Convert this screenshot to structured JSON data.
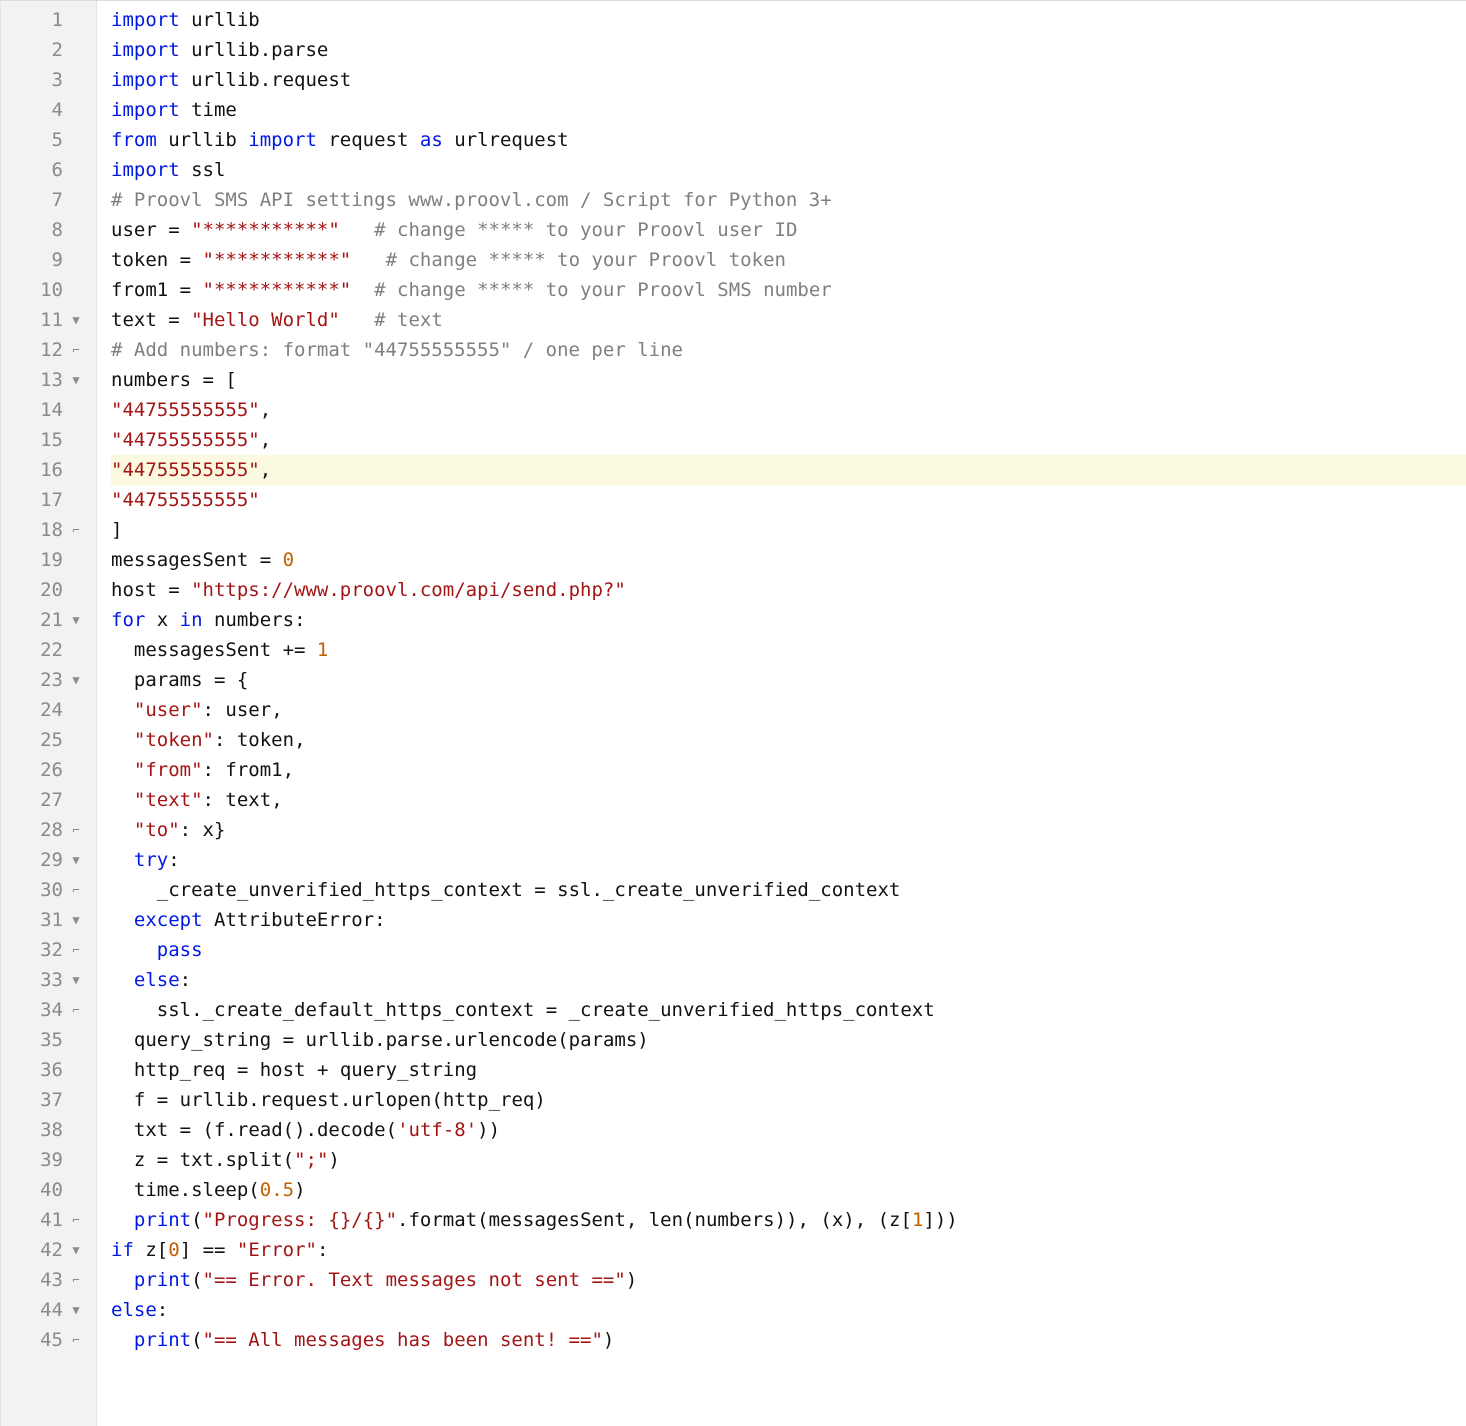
{
  "lines": [
    {
      "n": 1,
      "fold": "",
      "hl": false,
      "segs": [
        [
          "kw",
          "import"
        ],
        [
          "id",
          " urllib"
        ]
      ]
    },
    {
      "n": 2,
      "fold": "",
      "hl": false,
      "segs": [
        [
          "kw",
          "import"
        ],
        [
          "id",
          " urllib"
        ],
        [
          "op",
          "."
        ],
        [
          "id",
          "parse"
        ]
      ]
    },
    {
      "n": 3,
      "fold": "",
      "hl": false,
      "segs": [
        [
          "kw",
          "import"
        ],
        [
          "id",
          " urllib"
        ],
        [
          "op",
          "."
        ],
        [
          "id",
          "request"
        ]
      ]
    },
    {
      "n": 4,
      "fold": "",
      "hl": false,
      "segs": [
        [
          "kw",
          "import"
        ],
        [
          "id",
          " time"
        ]
      ]
    },
    {
      "n": 5,
      "fold": "",
      "hl": false,
      "segs": [
        [
          "kw",
          "from"
        ],
        [
          "id",
          " urllib "
        ],
        [
          "kw",
          "import"
        ],
        [
          "id",
          " request "
        ],
        [
          "kw",
          "as"
        ],
        [
          "id",
          " urlrequest"
        ]
      ]
    },
    {
      "n": 6,
      "fold": "",
      "hl": false,
      "segs": [
        [
          "kw",
          "import"
        ],
        [
          "id",
          " ssl"
        ]
      ]
    },
    {
      "n": 7,
      "fold": "",
      "hl": false,
      "segs": [
        [
          "cmt",
          "# Proovl SMS API settings www.proovl.com / Script for Python 3+"
        ]
      ]
    },
    {
      "n": 8,
      "fold": "",
      "hl": false,
      "segs": [
        [
          "id",
          "user "
        ],
        [
          "op",
          "= "
        ],
        [
          "str",
          "\"***********\""
        ],
        [
          "id",
          "   "
        ],
        [
          "cmt",
          "# change ***** to your Proovl user ID"
        ]
      ]
    },
    {
      "n": 9,
      "fold": "",
      "hl": false,
      "segs": [
        [
          "id",
          "token "
        ],
        [
          "op",
          "= "
        ],
        [
          "str",
          "\"***********\""
        ],
        [
          "id",
          "   "
        ],
        [
          "cmt",
          "# change ***** to your Proovl token"
        ]
      ]
    },
    {
      "n": 10,
      "fold": "",
      "hl": false,
      "segs": [
        [
          "id",
          "from1 "
        ],
        [
          "op",
          "= "
        ],
        [
          "str",
          "\"***********\""
        ],
        [
          "id",
          "  "
        ],
        [
          "cmt",
          "# change ***** to your Proovl SMS number"
        ]
      ]
    },
    {
      "n": 11,
      "fold": "▼",
      "hl": false,
      "segs": [
        [
          "id",
          "text "
        ],
        [
          "op",
          "= "
        ],
        [
          "str",
          "\"Hello World\""
        ],
        [
          "id",
          "   "
        ],
        [
          "cmt",
          "# text"
        ]
      ]
    },
    {
      "n": 12,
      "fold": "⌐",
      "hl": false,
      "segs": [
        [
          "cmt",
          "# Add numbers: format \"44755555555\" / one per line"
        ]
      ]
    },
    {
      "n": 13,
      "fold": "▼",
      "hl": false,
      "segs": [
        [
          "id",
          "numbers "
        ],
        [
          "op",
          "= ["
        ]
      ]
    },
    {
      "n": 14,
      "fold": "",
      "hl": false,
      "segs": [
        [
          "str",
          "\"44755555555\""
        ],
        [
          "op",
          ","
        ]
      ]
    },
    {
      "n": 15,
      "fold": "",
      "hl": false,
      "segs": [
        [
          "str",
          "\"44755555555\""
        ],
        [
          "op",
          ","
        ]
      ]
    },
    {
      "n": 16,
      "fold": "",
      "hl": true,
      "segs": [
        [
          "str",
          "\"44755555555\""
        ],
        [
          "op",
          ","
        ]
      ]
    },
    {
      "n": 17,
      "fold": "",
      "hl": false,
      "segs": [
        [
          "str",
          "\"44755555555\""
        ]
      ]
    },
    {
      "n": 18,
      "fold": "⌐",
      "hl": false,
      "segs": [
        [
          "op",
          "]"
        ]
      ]
    },
    {
      "n": 19,
      "fold": "",
      "hl": false,
      "segs": [
        [
          "id",
          "messagesSent "
        ],
        [
          "op",
          "= "
        ],
        [
          "num-lit",
          "0"
        ]
      ]
    },
    {
      "n": 20,
      "fold": "",
      "hl": false,
      "segs": [
        [
          "id",
          "host "
        ],
        [
          "op",
          "= "
        ],
        [
          "str",
          "\"https://www.proovl.com/api/send.php?\""
        ]
      ]
    },
    {
      "n": 21,
      "fold": "▼",
      "hl": false,
      "segs": [
        [
          "kw",
          "for"
        ],
        [
          "id",
          " x "
        ],
        [
          "kw",
          "in"
        ],
        [
          "id",
          " numbers"
        ],
        [
          "op",
          ":"
        ]
      ]
    },
    {
      "n": 22,
      "fold": "",
      "hl": false,
      "segs": [
        [
          "id",
          "  messagesSent "
        ],
        [
          "op",
          "+= "
        ],
        [
          "num-lit",
          "1"
        ]
      ]
    },
    {
      "n": 23,
      "fold": "▼",
      "hl": false,
      "segs": [
        [
          "id",
          "  params "
        ],
        [
          "op",
          "= {"
        ]
      ]
    },
    {
      "n": 24,
      "fold": "",
      "hl": false,
      "segs": [
        [
          "id",
          "  "
        ],
        [
          "str",
          "\"user\""
        ],
        [
          "op",
          ": "
        ],
        [
          "id",
          "user"
        ],
        [
          "op",
          ","
        ]
      ]
    },
    {
      "n": 25,
      "fold": "",
      "hl": false,
      "segs": [
        [
          "id",
          "  "
        ],
        [
          "str",
          "\"token\""
        ],
        [
          "op",
          ": "
        ],
        [
          "id",
          "token"
        ],
        [
          "op",
          ","
        ]
      ]
    },
    {
      "n": 26,
      "fold": "",
      "hl": false,
      "segs": [
        [
          "id",
          "  "
        ],
        [
          "str",
          "\"from\""
        ],
        [
          "op",
          ": "
        ],
        [
          "id",
          "from1"
        ],
        [
          "op",
          ","
        ]
      ]
    },
    {
      "n": 27,
      "fold": "",
      "hl": false,
      "segs": [
        [
          "id",
          "  "
        ],
        [
          "str",
          "\"text\""
        ],
        [
          "op",
          ": "
        ],
        [
          "id",
          "text"
        ],
        [
          "op",
          ","
        ]
      ]
    },
    {
      "n": 28,
      "fold": "⌐",
      "hl": false,
      "segs": [
        [
          "id",
          "  "
        ],
        [
          "str",
          "\"to\""
        ],
        [
          "op",
          ": "
        ],
        [
          "id",
          "x"
        ],
        [
          "op",
          "}"
        ]
      ]
    },
    {
      "n": 29,
      "fold": "▼",
      "hl": false,
      "segs": [
        [
          "id",
          "  "
        ],
        [
          "kw",
          "try"
        ],
        [
          "op",
          ":"
        ]
      ]
    },
    {
      "n": 30,
      "fold": "⌐",
      "hl": false,
      "segs": [
        [
          "id",
          "    _create_unverified_https_context "
        ],
        [
          "op",
          "= "
        ],
        [
          "id",
          "ssl"
        ],
        [
          "op",
          "."
        ],
        [
          "id",
          "_create_unverified_context"
        ]
      ]
    },
    {
      "n": 31,
      "fold": "▼",
      "hl": false,
      "segs": [
        [
          "id",
          "  "
        ],
        [
          "kw",
          "except"
        ],
        [
          "id",
          " AttributeError"
        ],
        [
          "op",
          ":"
        ]
      ]
    },
    {
      "n": 32,
      "fold": "⌐",
      "hl": false,
      "segs": [
        [
          "id",
          "    "
        ],
        [
          "kw",
          "pass"
        ]
      ]
    },
    {
      "n": 33,
      "fold": "▼",
      "hl": false,
      "segs": [
        [
          "id",
          "  "
        ],
        [
          "kw",
          "else"
        ],
        [
          "op",
          ":"
        ]
      ]
    },
    {
      "n": 34,
      "fold": "⌐",
      "hl": false,
      "segs": [
        [
          "id",
          "    ssl"
        ],
        [
          "op",
          "."
        ],
        [
          "id",
          "_create_default_https_context "
        ],
        [
          "op",
          "= "
        ],
        [
          "id",
          "_create_unverified_https_context"
        ]
      ]
    },
    {
      "n": 35,
      "fold": "",
      "hl": false,
      "segs": [
        [
          "id",
          "  query_string "
        ],
        [
          "op",
          "= "
        ],
        [
          "id",
          "urllib"
        ],
        [
          "op",
          "."
        ],
        [
          "id",
          "parse"
        ],
        [
          "op",
          "."
        ],
        [
          "id",
          "urlencode"
        ],
        [
          "op",
          "("
        ],
        [
          "id",
          "params"
        ],
        [
          "op",
          ")"
        ]
      ]
    },
    {
      "n": 36,
      "fold": "",
      "hl": false,
      "segs": [
        [
          "id",
          "  http_req "
        ],
        [
          "op",
          "= "
        ],
        [
          "id",
          "host "
        ],
        [
          "op",
          "+ "
        ],
        [
          "id",
          "query_string"
        ]
      ]
    },
    {
      "n": 37,
      "fold": "",
      "hl": false,
      "segs": [
        [
          "id",
          "  f "
        ],
        [
          "op",
          "= "
        ],
        [
          "id",
          "urllib"
        ],
        [
          "op",
          "."
        ],
        [
          "id",
          "request"
        ],
        [
          "op",
          "."
        ],
        [
          "id",
          "urlopen"
        ],
        [
          "op",
          "("
        ],
        [
          "id",
          "http_req"
        ],
        [
          "op",
          ")"
        ]
      ]
    },
    {
      "n": 38,
      "fold": "",
      "hl": false,
      "segs": [
        [
          "id",
          "  txt "
        ],
        [
          "op",
          "= ("
        ],
        [
          "id",
          "f"
        ],
        [
          "op",
          "."
        ],
        [
          "id",
          "read"
        ],
        [
          "op",
          "()."
        ],
        [
          "id",
          "decode"
        ],
        [
          "op",
          "("
        ],
        [
          "str",
          "'utf-8'"
        ],
        [
          "op",
          "))"
        ]
      ]
    },
    {
      "n": 39,
      "fold": "",
      "hl": false,
      "segs": [
        [
          "id",
          "  z "
        ],
        [
          "op",
          "= "
        ],
        [
          "id",
          "txt"
        ],
        [
          "op",
          "."
        ],
        [
          "id",
          "split"
        ],
        [
          "op",
          "("
        ],
        [
          "str",
          "\";\""
        ],
        [
          "op",
          ")"
        ]
      ]
    },
    {
      "n": 40,
      "fold": "",
      "hl": false,
      "segs": [
        [
          "id",
          "  time"
        ],
        [
          "op",
          "."
        ],
        [
          "id",
          "sleep"
        ],
        [
          "op",
          "("
        ],
        [
          "num-lit",
          "0.5"
        ],
        [
          "op",
          ")"
        ]
      ]
    },
    {
      "n": 41,
      "fold": "⌐",
      "hl": false,
      "segs": [
        [
          "id",
          "  "
        ],
        [
          "kw",
          "print"
        ],
        [
          "op",
          "("
        ],
        [
          "str",
          "\"Progress: {}/{}\""
        ],
        [
          "op",
          "."
        ],
        [
          "id",
          "format"
        ],
        [
          "op",
          "("
        ],
        [
          "id",
          "messagesSent"
        ],
        [
          "op",
          ", "
        ],
        [
          "id",
          "len"
        ],
        [
          "op",
          "("
        ],
        [
          "id",
          "numbers"
        ],
        [
          "op",
          "))"
        ],
        [
          "op",
          ", ("
        ],
        [
          "id",
          "x"
        ],
        [
          "op",
          "), ("
        ],
        [
          "id",
          "z"
        ],
        [
          "op",
          "["
        ],
        [
          "num-lit",
          "1"
        ],
        [
          "op",
          "]))"
        ]
      ]
    },
    {
      "n": 42,
      "fold": "▼",
      "hl": false,
      "segs": [
        [
          "kw",
          "if"
        ],
        [
          "id",
          " z"
        ],
        [
          "op",
          "["
        ],
        [
          "num-lit",
          "0"
        ],
        [
          "op",
          "] "
        ],
        [
          "op",
          "== "
        ],
        [
          "str",
          "\"Error\""
        ],
        [
          "op",
          ":"
        ]
      ]
    },
    {
      "n": 43,
      "fold": "⌐",
      "hl": false,
      "segs": [
        [
          "id",
          "  "
        ],
        [
          "kw",
          "print"
        ],
        [
          "op",
          "("
        ],
        [
          "str",
          "\"== Error. Text messages not sent ==\""
        ],
        [
          "op",
          ")"
        ]
      ]
    },
    {
      "n": 44,
      "fold": "▼",
      "hl": false,
      "segs": [
        [
          "kw",
          "else"
        ],
        [
          "op",
          ":"
        ]
      ]
    },
    {
      "n": 45,
      "fold": "⌐",
      "hl": false,
      "segs": [
        [
          "id",
          "  "
        ],
        [
          "kw",
          "print"
        ],
        [
          "op",
          "("
        ],
        [
          "str",
          "\"== All messages has been sent! ==\""
        ],
        [
          "op",
          ")"
        ]
      ]
    }
  ]
}
